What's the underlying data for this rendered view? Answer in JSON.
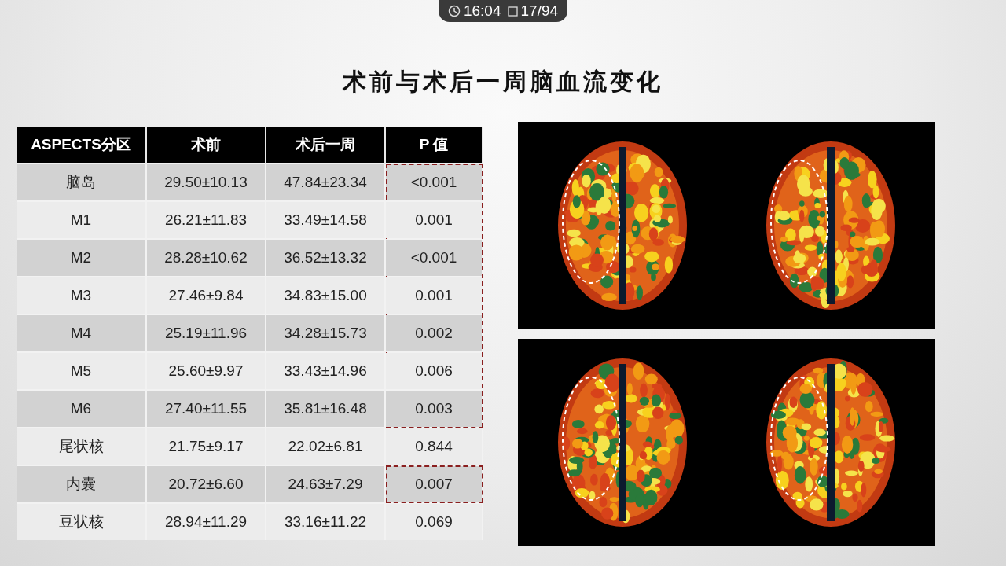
{
  "player_bar": {
    "time": "16:04",
    "page": "17/94"
  },
  "slide": {
    "title": "术前与术后一周脑血流变化",
    "table": {
      "columns": [
        "ASPECTS分区",
        "术前",
        "术后一周",
        "P 值"
      ],
      "row_groups": [
        {
          "highlighted": true,
          "rows": [
            [
              "脑岛",
              "29.50±10.13",
              "47.84±23.34",
              "<0.001"
            ],
            [
              "M1",
              "26.21±11.83",
              "33.49±14.58",
              "0.001"
            ],
            [
              "M2",
              "28.28±10.62",
              "36.52±13.32",
              "<0.001"
            ],
            [
              "M3",
              "27.46±9.84",
              "34.83±15.00",
              "0.001"
            ],
            [
              "M4",
              "25.19±11.96",
              "34.28±15.73",
              "0.002"
            ],
            [
              "M5",
              "25.60±9.97",
              "33.43±14.96",
              "0.006"
            ],
            [
              "M6",
              "27.40±11.55",
              "35.81±16.48",
              "0.003"
            ]
          ]
        },
        {
          "highlighted": false,
          "rows": [
            [
              "尾状核",
              "21.75±9.17",
              "22.02±6.81",
              "0.844"
            ]
          ]
        },
        {
          "highlighted": true,
          "rows": [
            [
              "内囊",
              "20.72±6.60",
              "24.63±7.29",
              "0.007"
            ]
          ]
        },
        {
          "highlighted": false,
          "rows": [
            [
              "豆状核",
              "28.94±11.29",
              "33.16±11.22",
              "0.069"
            ]
          ]
        }
      ]
    }
  }
}
